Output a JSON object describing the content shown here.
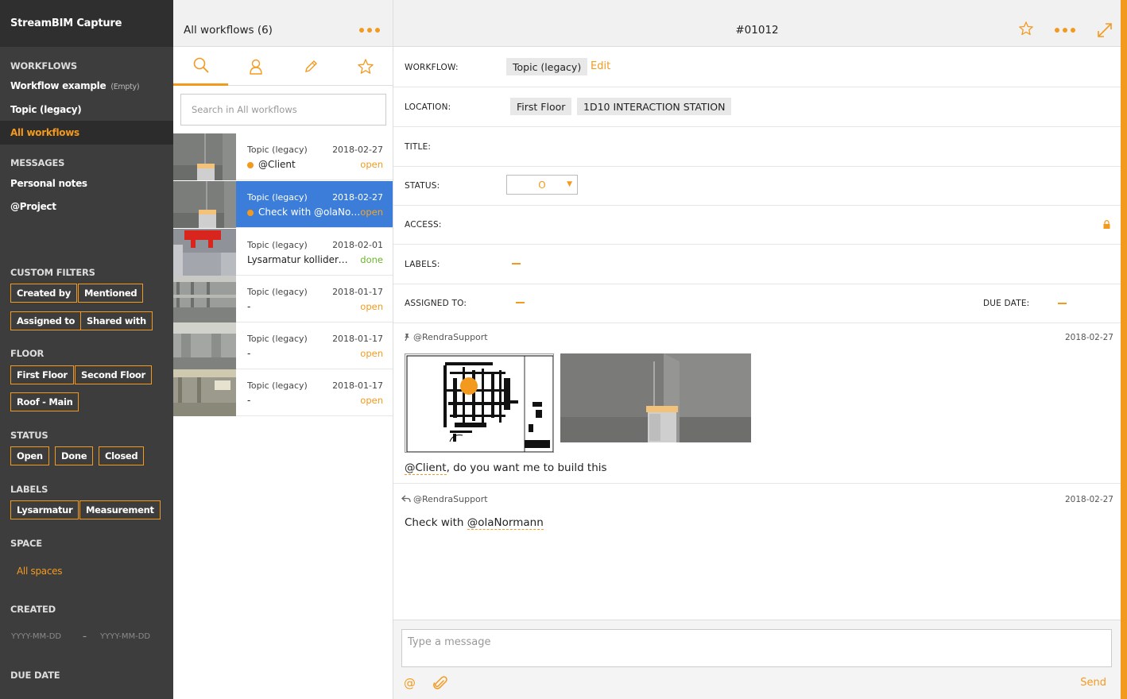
{
  "app": {
    "title": "StreamBIM Capture"
  },
  "sidebar": {
    "workflows_heading": "WORKFLOWS",
    "workflow_example": "Workflow example",
    "workflow_example_badge": "(Empty)",
    "topic_legacy": "Topic (legacy)",
    "all_workflows": "All workflows",
    "messages_heading": "MESSAGES",
    "personal_notes": "Personal notes",
    "project": "@Project",
    "custom_filters_heading": "CUSTOM FILTERS",
    "custom_filters": [
      "Created by",
      "Mentioned",
      "Assigned to",
      "Shared with"
    ],
    "floor_heading": "FLOOR",
    "floors": [
      "First Floor",
      "Second Floor",
      "Roof - Main"
    ],
    "status_heading": "STATUS",
    "statuses": [
      "Open",
      "Done",
      "Closed"
    ],
    "labels_heading": "LABELS",
    "labels": [
      "Lysarmatur",
      "Measurement"
    ],
    "space_heading": "SPACE",
    "all_spaces": "All spaces",
    "created_heading": "CREATED",
    "date_placeholder_from": "YYYY-MM-DD",
    "date_separator": "–",
    "date_placeholder_to": "YYYY-MM-DD",
    "due_date_heading": "DUE DATE"
  },
  "list": {
    "title": "All workflows (6)",
    "search_placeholder": "Search in All workflows",
    "rows": [
      {
        "type": "Topic (legacy)",
        "date": "2018-02-27",
        "subject": "@Client",
        "state": "open",
        "dot": true,
        "selected": false
      },
      {
        "type": "Topic (legacy)",
        "date": "2018-02-27",
        "subject": "Check with @olaNormann",
        "state": "open",
        "dot": true,
        "selected": true
      },
      {
        "type": "Topic (legacy)",
        "date": "2018-02-01",
        "subject": "Lysarmatur kolliderer med",
        "state": "done",
        "dot": false,
        "selected": false
      },
      {
        "type": "Topic (legacy)",
        "date": "2018-01-17",
        "subject": "-",
        "state": "open",
        "dot": false,
        "selected": false
      },
      {
        "type": "Topic (legacy)",
        "date": "2018-01-17",
        "subject": "-",
        "state": "open",
        "dot": false,
        "selected": false
      },
      {
        "type": "Topic (legacy)",
        "date": "2018-01-17",
        "subject": "-",
        "state": "open",
        "dot": false,
        "selected": false
      }
    ]
  },
  "detail": {
    "number": "#01012",
    "workflow_label": "WORKFLOW:",
    "workflow_value": "Topic (legacy)",
    "edit": "Edit",
    "location_label": "LOCATION:",
    "location_floor": "First Floor",
    "location_space": "1D10 INTERACTION STATION",
    "title_label": "TITLE:",
    "status_label": "STATUS:",
    "status_value": "O",
    "access_label": "ACCESS:",
    "labels_label": "LABELS:",
    "assigned_label": "ASSIGNED TO:",
    "due_label": "DUE DATE:",
    "messages": [
      {
        "author": "@RendraSupport",
        "date": "2018-02-27",
        "mention": "@Client",
        "text": ", do you want me to build this"
      },
      {
        "author": "@RendraSupport",
        "date": "2018-02-27",
        "prefix": "Check with ",
        "mention": "@olaNormann"
      }
    ],
    "composer_placeholder": "Type a message",
    "send": "Send"
  },
  "colors": {
    "accent": "#f39a1e",
    "selected": "#3b7dd8",
    "sidebar": "#3d3d3d",
    "done": "#6bb52a"
  }
}
